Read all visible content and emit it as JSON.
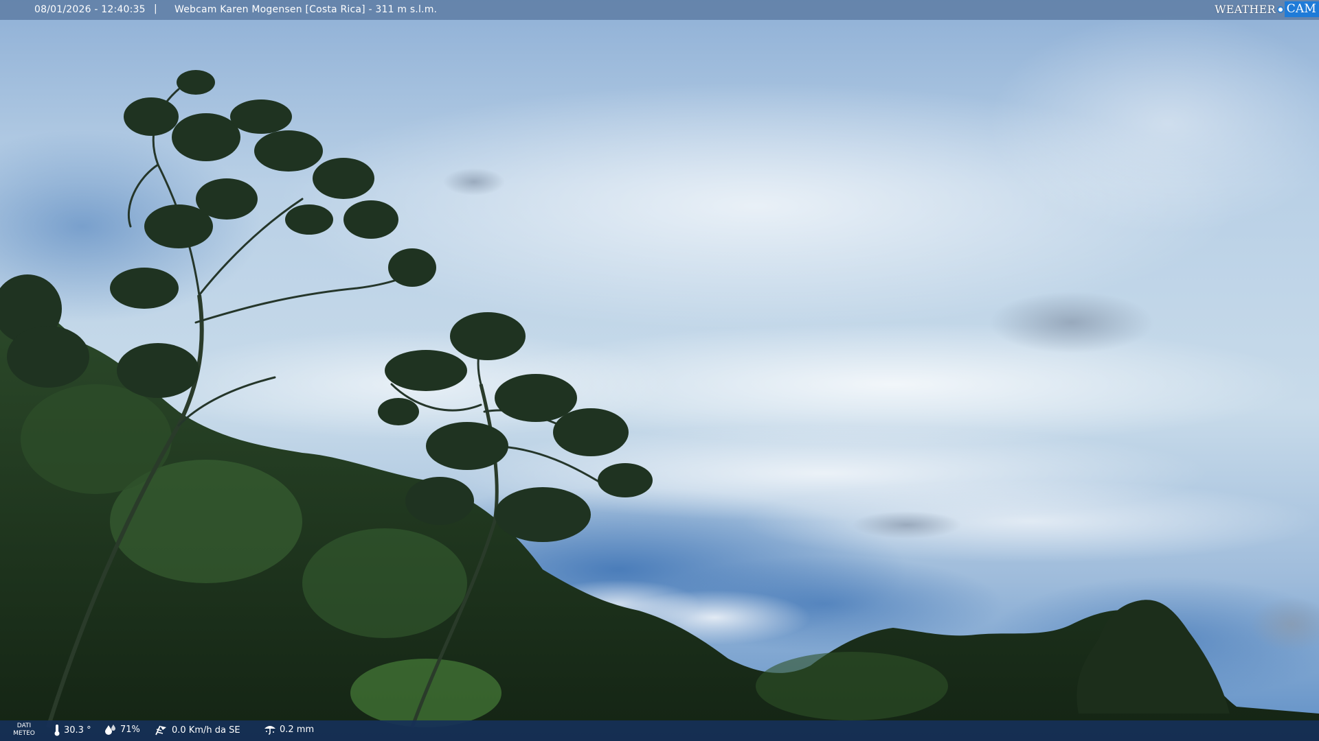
{
  "header": {
    "timestamp": "08/01/2026 - 12:40:35",
    "separator": "|",
    "title": "Webcam Karen Mogensen [Costa Rica] - 311 m s.l.m."
  },
  "logo": {
    "word": "WEATHER",
    "accent": "CAM",
    "accent_color": "#1f7bd8"
  },
  "footer": {
    "section_label_line1": "DATI",
    "section_label_line2": "METEO",
    "temperature": "30.3 °",
    "humidity": "71%",
    "wind": "0.0 Km/h da SE",
    "rain": "0.2 mm",
    "icons": {
      "temperature": "thermometer-icon",
      "humidity": "humidity-drop-icon",
      "wind": "wind-icon",
      "rain": "rain-icon"
    }
  },
  "colors": {
    "sky_top": "#8fb0d6",
    "sky_mid": "#c9dcea",
    "sky_blue": "#4f7fb8",
    "foliage": "#1f3320",
    "bar_top": "#5a78a0",
    "bar_bottom": "#163058"
  }
}
